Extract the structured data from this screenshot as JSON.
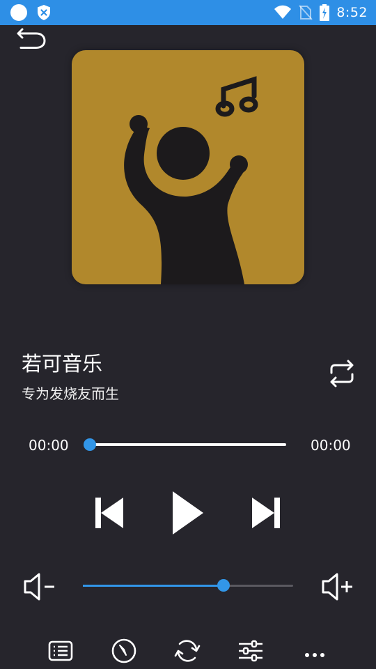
{
  "status_bar": {
    "time": "8:52",
    "icons": [
      "circle-icon",
      "shield-icon",
      "wifi-icon",
      "no-sim-icon",
      "battery-icon"
    ]
  },
  "track": {
    "title": "若可音乐",
    "subtitle": "专为发烧友而生"
  },
  "progress": {
    "current_time": "00:00",
    "total_time": "00:00",
    "fraction": 0.0
  },
  "volume": {
    "fraction": 0.67
  },
  "controls": [
    "previous-icon",
    "play-icon",
    "next-icon"
  ],
  "bottom_bar": [
    "playlist-icon",
    "timer-icon",
    "refresh-icon",
    "equalizer-icon",
    "more-icon"
  ],
  "colors": {
    "status_bar": "#2e8fe6",
    "background": "#26252c",
    "accent": "#3296e8",
    "album_art": "#b1882c"
  }
}
